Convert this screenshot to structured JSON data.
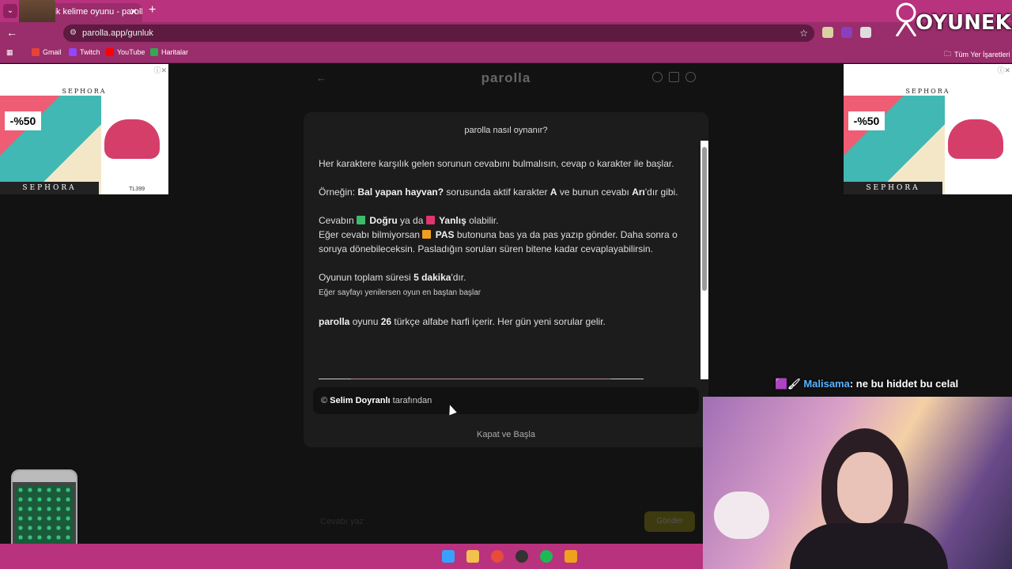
{
  "browser": {
    "tab_title": "lik kelime oyunu - parolla",
    "tab_close": "✕",
    "new_tab": "+",
    "url": "parolla.app/gunluk",
    "bookmarks": [
      {
        "label": "Gmail",
        "color": "#ea4335"
      },
      {
        "label": "Twitch",
        "color": "#9146ff"
      },
      {
        "label": "YouTube",
        "color": "#ff0000"
      },
      {
        "label": "Haritalar",
        "color": "#34a853"
      }
    ],
    "all_bookmarks": "Tüm Yer İşaretleri"
  },
  "overlay": {
    "logo": "OYUNEKS",
    "chat_user": "Malisama",
    "chat_message": ": ne bu hiddet bu celal"
  },
  "ads": {
    "brand": "SEPHORA",
    "discount": "-%50",
    "price": "TL399"
  },
  "game": {
    "title": "parolla",
    "answer_placeholder": "Cevabı yaz",
    "answer_button": "Gönder"
  },
  "modal": {
    "title": "parolla nasıl oynanır?",
    "p1": "Her karaktere karşılık gelen sorunun cevabını bulmalısın, cevap o karakter ile başlar.",
    "p2_a": "Örneğin: ",
    "p2_b": "Bal yapan hayvan?",
    "p2_c": " sorusunda aktif karakter ",
    "p2_d": "A",
    "p2_e": " ve bunun cevabı ",
    "p2_f": "Arı",
    "p2_g": "'dır gibi.",
    "p3_a": "Cevabın ",
    "p3_b": "Doğru",
    "p3_c": " ya da ",
    "p3_d": "Yanlış",
    "p3_e": " olabilir.",
    "p4_a": "Eğer cevabı bilmiyorsan ",
    "p4_b": "PAS",
    "p4_c": " butonuna bas ya da pas yazıp gönder. Daha sonra o soruya dönebileceksin. Pasladığın soruları süren bitene kadar cevaplayabilirsin.",
    "p5_a": "Oyunun toplam süresi ",
    "p5_b": "5 dakika",
    "p5_c": "'dır.",
    "p5_small": "Eğer sayfayı yenilersen oyun en baştan başlar",
    "p6_a": "parolla",
    "p6_b": " oyunu ",
    "p6_c": "26",
    "p6_d": " türkçe alfabe harfi içerir. Her gün yeni sorular gelir.",
    "author_a": "© ",
    "author_b": "Selim Doyranlı",
    "author_c": " tarafından",
    "close_start": "Kapat ve Başla"
  },
  "colors": {
    "correct": "#3dbb6a",
    "wrong": "#e0356d",
    "pass": "#f0a020"
  }
}
